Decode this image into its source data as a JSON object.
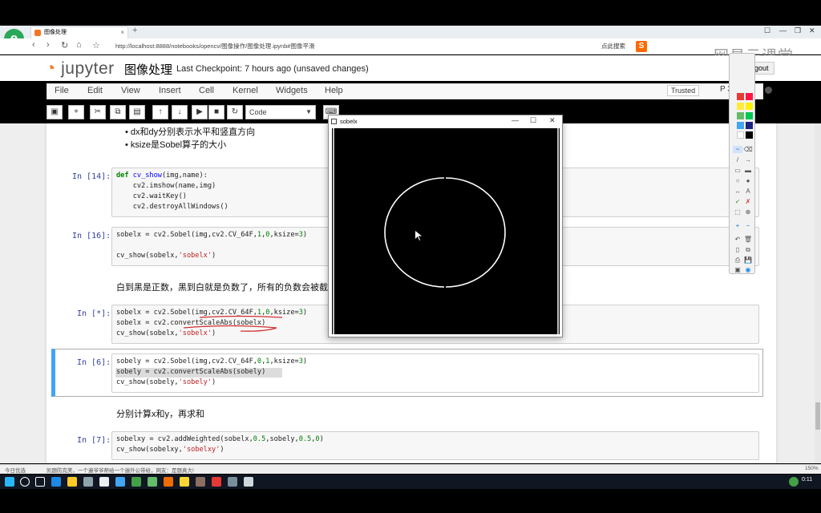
{
  "browser": {
    "tab_title": "图像处理",
    "url": "http://localhost:8888/notebooks/opencv/图像操作/图像处理.ipynb#图像平滑",
    "search_hint": "点此搜索",
    "brand": "网易云课堂",
    "new_tab": "+"
  },
  "jupyter": {
    "logo": "jupyter",
    "notebook_name": "图像处理",
    "checkpoint": "Last Checkpoint: 7 hours ago (unsaved changes)",
    "logout": "Logout",
    "trusted": "Trusted",
    "kernel": "P 3",
    "menu": [
      "File",
      "Edit",
      "View",
      "Insert",
      "Cell",
      "Kernel",
      "Widgets",
      "Help"
    ],
    "cell_type": "Code"
  },
  "cells": {
    "bullets": [
      "dx和dy分别表示水平和竖直方向",
      "ksize是Sobel算子的大小"
    ],
    "p14": "In [14]:",
    "c14": [
      "def cv_show(img,name):",
      "    cv2.imshow(name,img)",
      "    cv2.waitKey()",
      "    cv2.destroyAllWindows()"
    ],
    "p16": "In [16]:",
    "c16": [
      "sobelx = cv2.Sobel(img,cv2.CV_64F,1,0,ksize=3)",
      "",
      "cv_show(sobelx,'sobelx')"
    ],
    "md1": "白到黑是正数，黑到白就是负数了，所有的负数会被截",
    "pstar": "In [*]:",
    "cstar": [
      "sobelx = cv2.Sobel(img,cv2.CV_64F,1,0,ksize=3)",
      "sobelx = cv2.convertScaleAbs(sobelx)",
      "cv_show(sobelx,'sobelx')"
    ],
    "p6": "In [6]:",
    "c6": [
      "sobely = cv2.Sobel(img,cv2.CV_64F,0,1,ksize=3)",
      "sobely = cv2.convertScaleAbs(sobely)",
      "cv_show(sobely,'sobely')"
    ],
    "md2": "分别计算x和y，再求和",
    "p7": "In [7]:",
    "c7": [
      "sobelxy = cv2.addWeighted(sobelx,0.5,sobely,0.5,0)",
      "cv_show(sobelxy,'sobelxy')"
    ]
  },
  "cv_window": {
    "title": "sobelx"
  },
  "status": {
    "left": "今日优选",
    "news": "凯题防完美，一个遍爷爷帮给一个遍外公带给，网友：是题真大!",
    "zoom": "150%",
    "clock": "0:11"
  },
  "colors": {
    "accent": "#42a5f5",
    "jupyter_orange": "#f37626",
    "prompt": "#303f9f",
    "ink": "#d32f2f"
  }
}
